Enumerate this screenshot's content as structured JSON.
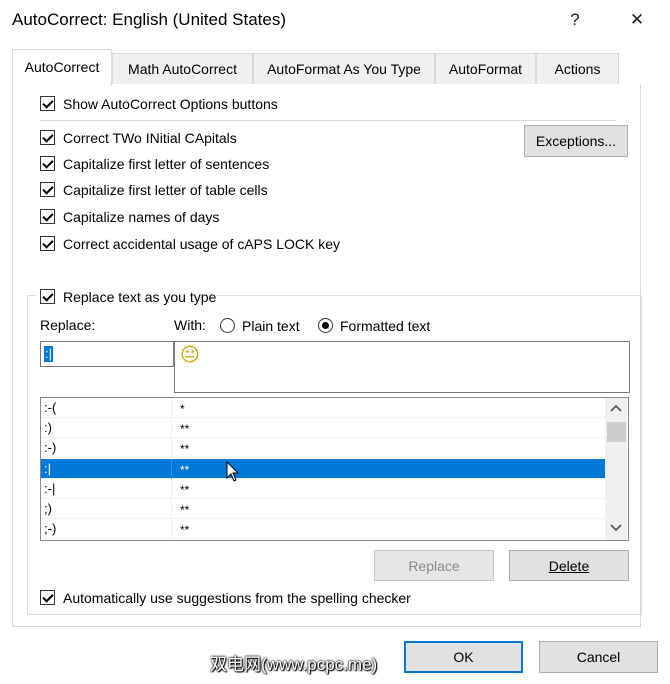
{
  "window": {
    "title": "AutoCorrect: English (United States)",
    "help_glyph": "?",
    "close_glyph": "✕"
  },
  "tabs": [
    {
      "label": "AutoCorrect",
      "active": true
    },
    {
      "label": "Math AutoCorrect",
      "active": false
    },
    {
      "label": "AutoFormat As You Type",
      "active": false
    },
    {
      "label": "AutoFormat",
      "active": false
    },
    {
      "label": "Actions",
      "active": false
    }
  ],
  "options": {
    "show_buttons": "Show AutoCorrect Options buttons",
    "two_initial": "Correct TWo INitial CApitals",
    "first_letter_sentences": "Capitalize first letter of sentences",
    "first_letter_cells": "Capitalize first letter of table cells",
    "names_of_days": "Capitalize names of days",
    "caps_lock": "Correct accidental usage of cAPS LOCK key",
    "exceptions_button": "Exceptions..."
  },
  "replace_section": {
    "replace_as_you_type": "Replace text as you type",
    "replace_label": "Replace:",
    "with_label": "With:",
    "plain_text": "Plain text",
    "formatted_text": "Formatted text",
    "replace_value": ":|",
    "with_value": "😐",
    "table": [
      {
        "replace": ":-(",
        "with": "*"
      },
      {
        "replace": ":)",
        "with": "**"
      },
      {
        "replace": ":-)",
        "with": "**"
      },
      {
        "replace": ":|",
        "with": "**",
        "selected": true
      },
      {
        "replace": ":-|",
        "with": "**"
      },
      {
        "replace": ";)",
        "with": "**"
      },
      {
        "replace": ";-)",
        "with": "**"
      }
    ],
    "replace_button": "Replace",
    "delete_button": "Delete",
    "auto_suggestions": "Automatically use suggestions from the spelling checker"
  },
  "footer": {
    "ok_button": "OK",
    "cancel_button": "Cancel",
    "watermark": "双电网(www.pcpc.me)"
  },
  "colors": {
    "accent": "#0078d7",
    "selected_row": "#0078d7"
  }
}
